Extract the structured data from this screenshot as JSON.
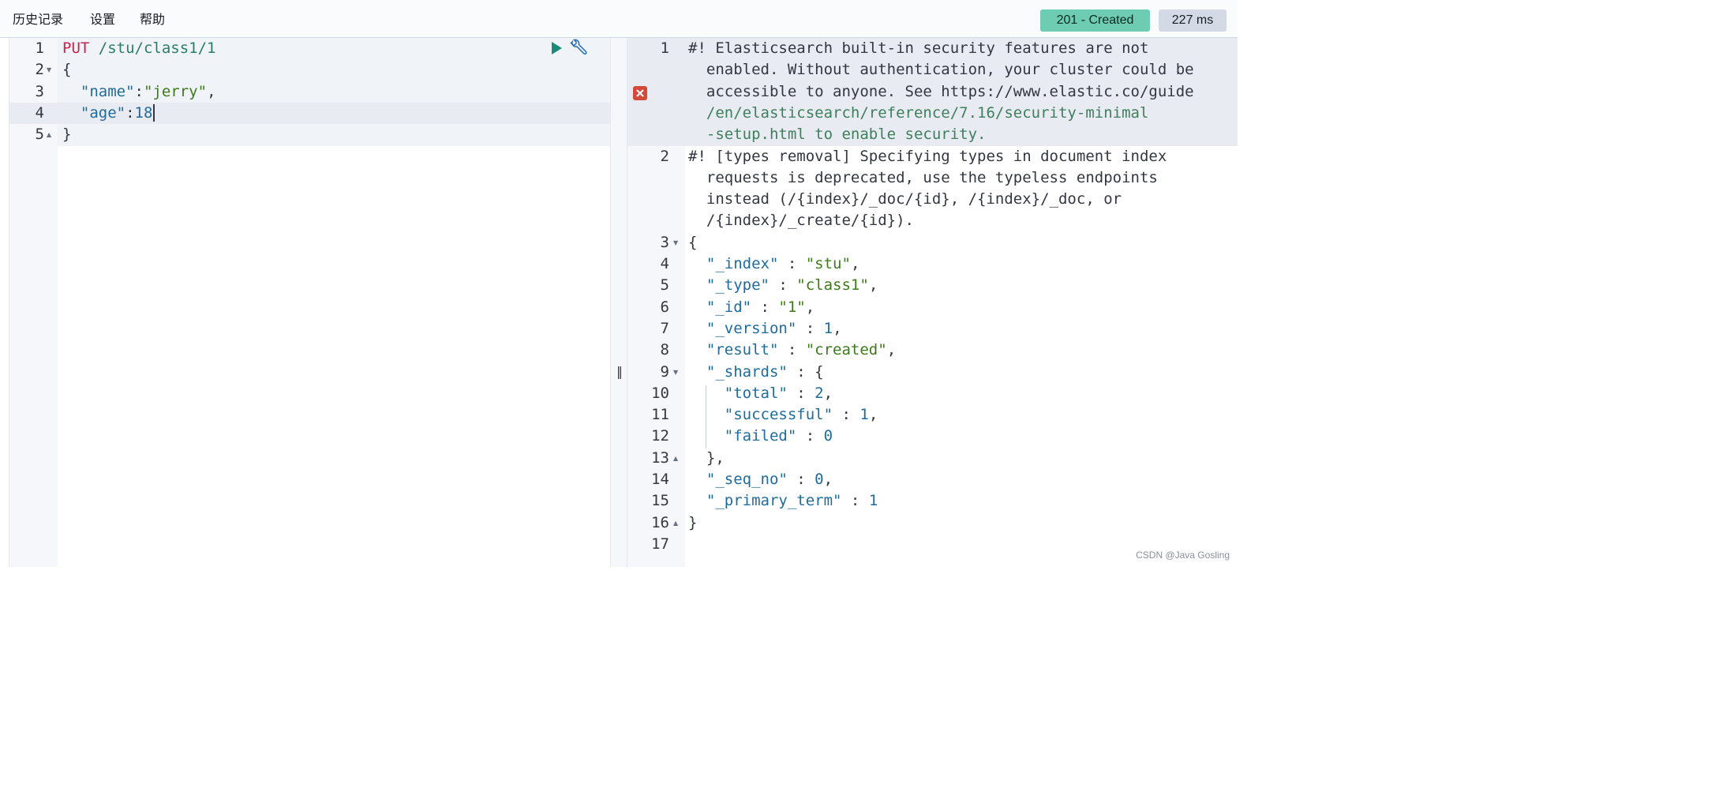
{
  "menu": {
    "history": "历史记录",
    "settings": "设置",
    "help": "帮助"
  },
  "status": {
    "code_text": "201 - Created",
    "time_text": "227 ms",
    "color": "#6dccb1"
  },
  "request": {
    "method": "PUT",
    "path": " /stu/class1/1",
    "lines": [
      {
        "num": "1"
      },
      {
        "num": "2",
        "text": "{"
      },
      {
        "num": "3",
        "key": "\"name\"",
        "sep": ":",
        "value": "\"jerry\"",
        "tail": ","
      },
      {
        "num": "4",
        "key": "\"age\"",
        "sep": ":",
        "value": "18"
      },
      {
        "num": "5",
        "text": "}"
      }
    ]
  },
  "response": {
    "lines": [
      {
        "num": "1",
        "rows": [
          "#! Elasticsearch built-in security features are not",
          "  enabled. Without authentication, your cluster could be",
          "  accessible to anyone. See https://www.elastic.co/guide",
          "  /en/elasticsearch/reference/7.16/security-minimal",
          "  -setup.html to enable security."
        ]
      },
      {
        "num": "2",
        "rows": [
          "#! [types removal] Specifying types in document index",
          "  requests is deprecated, use the typeless endpoints",
          "  instead (/{index}/_doc/{id}, /{index}/_doc, or",
          "  /{index}/_create/{id})."
        ]
      },
      {
        "num": "3",
        "text": "{"
      },
      {
        "num": "4",
        "key": "\"_index\"",
        "value": "\"stu\"",
        "tail": ","
      },
      {
        "num": "5",
        "key": "\"_type\"",
        "value": "\"class1\"",
        "tail": ","
      },
      {
        "num": "6",
        "key": "\"_id\"",
        "value": "\"1\"",
        "tail": ","
      },
      {
        "num": "7",
        "key": "\"_version\"",
        "value": "1",
        "tail": ","
      },
      {
        "num": "8",
        "key": "\"result\"",
        "value": "\"created\"",
        "tail": ","
      },
      {
        "num": "9",
        "key": "\"_shards\"",
        "value": "{",
        "tail": ""
      },
      {
        "num": "10",
        "key": "\"total\"",
        "value": "2",
        "tail": ","
      },
      {
        "num": "11",
        "key": "\"successful\"",
        "value": "1",
        "tail": ","
      },
      {
        "num": "12",
        "key": "\"failed\"",
        "value": "0",
        "tail": ""
      },
      {
        "num": "13",
        "text": "  },"
      },
      {
        "num": "14",
        "key": "\"_seq_no\"",
        "value": "0",
        "tail": ","
      },
      {
        "num": "15",
        "key": "\"_primary_term\"",
        "value": "1",
        "tail": ""
      },
      {
        "num": "16",
        "text": "}"
      },
      {
        "num": "17",
        "text": ""
      }
    ],
    "separator": " : "
  },
  "icons": {
    "run": "play-icon",
    "settings": "wrench-icon",
    "error": "error-icon",
    "resize": "resize-handle-icon"
  },
  "divider": {
    "handle": "‖"
  },
  "watermark": "CSDN @Java Gosling"
}
